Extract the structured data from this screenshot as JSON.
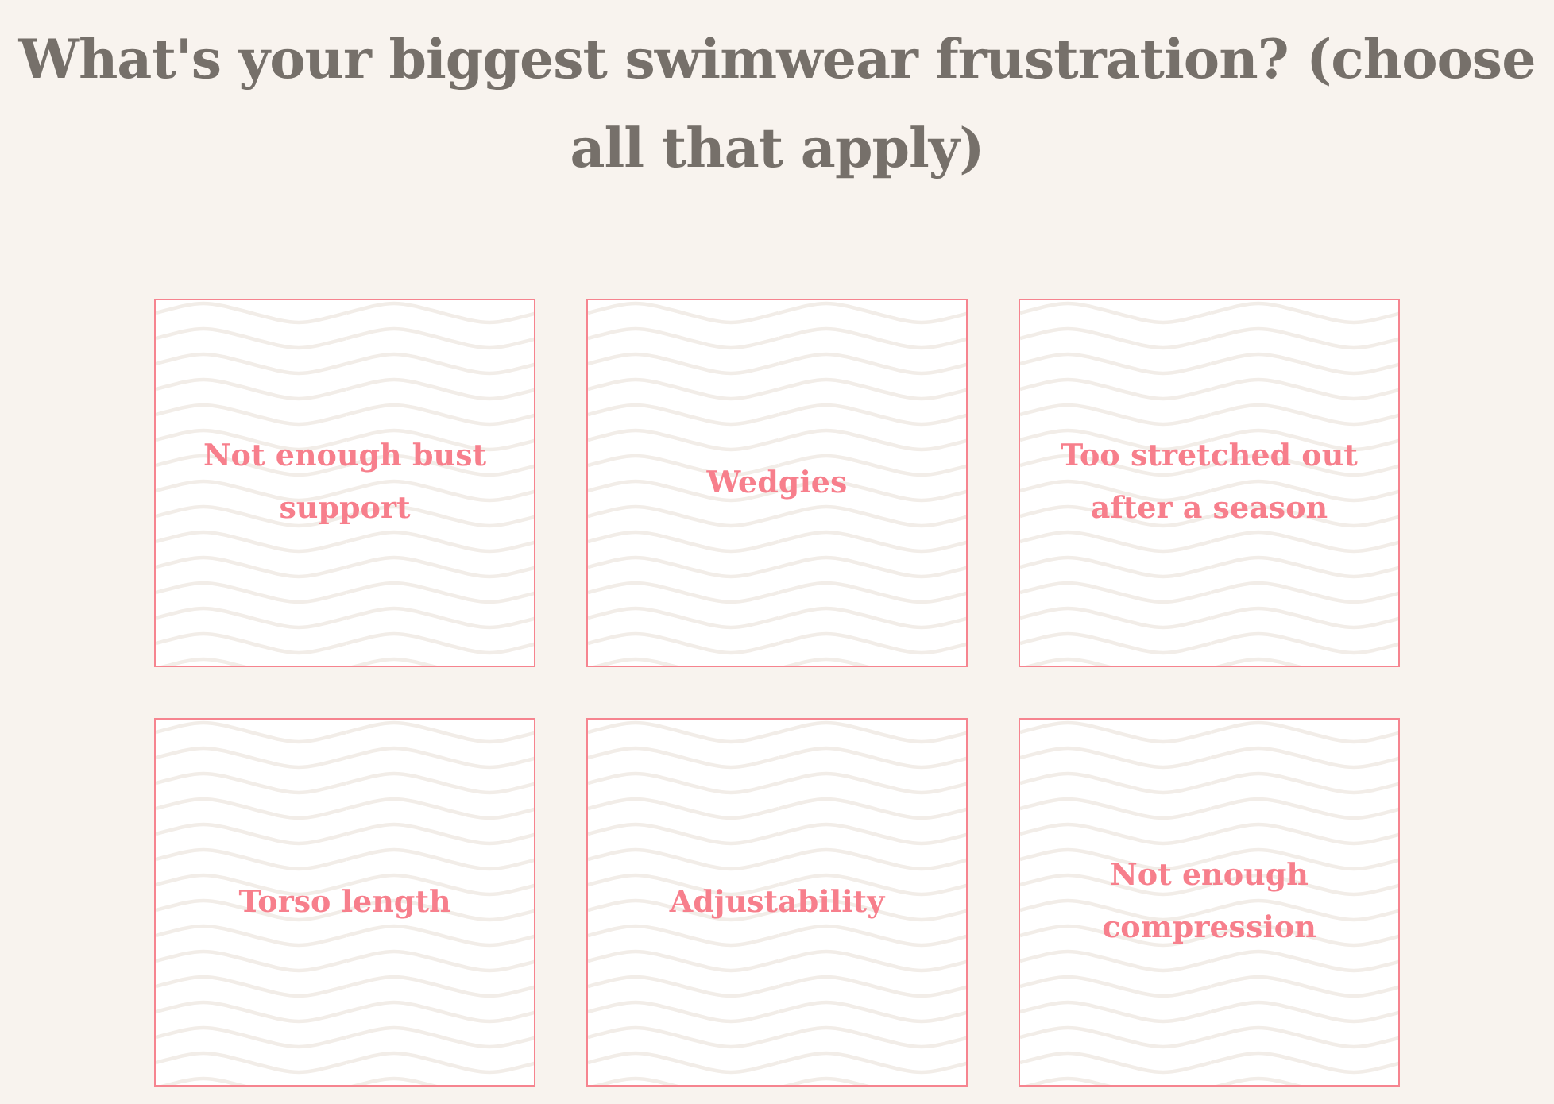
{
  "question": "What's your biggest swimwear frustration? (choose all that apply)",
  "options": [
    {
      "label": "Not enough bust support",
      "selected": false
    },
    {
      "label": "Wedgies",
      "selected": false
    },
    {
      "label": "Too stretched out after a season",
      "selected": false
    },
    {
      "label": "Torso length",
      "selected": false
    },
    {
      "label": "Adjustability",
      "selected": false
    },
    {
      "label": "Not enough compression",
      "selected": false
    }
  ]
}
